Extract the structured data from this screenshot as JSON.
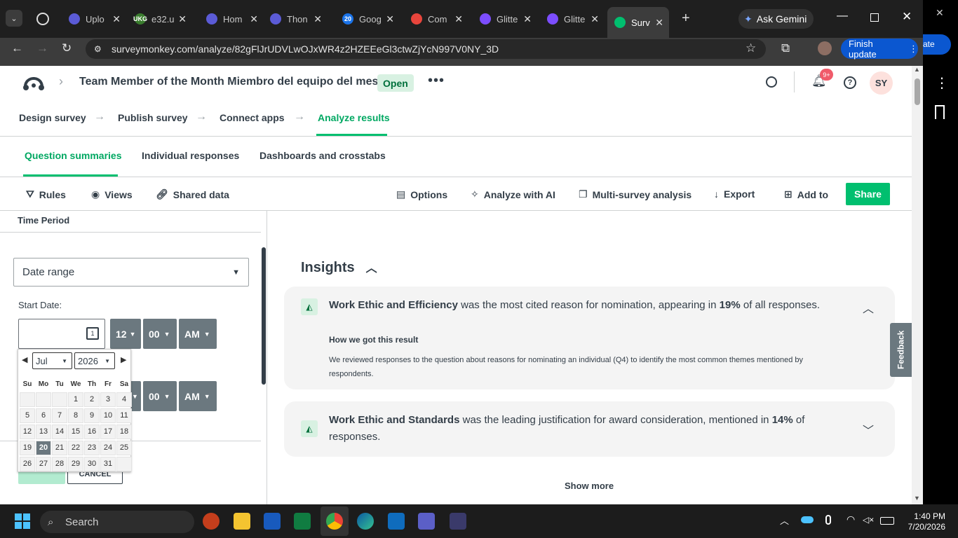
{
  "browser": {
    "tabs": [
      {
        "label": "Uplo",
        "color": "#5b5bd6"
      },
      {
        "label": "e32.u",
        "color": "#3a7d2e",
        "fav_text": "UKG"
      },
      {
        "label": "Hom",
        "color": "#5b5bd6"
      },
      {
        "label": "Thon",
        "color": "#5b5bd6"
      },
      {
        "label": "Goog",
        "color": "#1a73e8",
        "fav_text": "20"
      },
      {
        "label": "Com",
        "color": "#e8453c"
      },
      {
        "label": "Glitte",
        "color": "#7c4dff"
      },
      {
        "label": "Glitte",
        "color": "#7c4dff"
      },
      {
        "label": "Surv",
        "color": "#00bf6f"
      }
    ],
    "gemini_label": "Ask Gemini",
    "url": "surveymonkey.com/analyze/82gFlJrUDVLwOJxWR4z2HZEEeGl3ctwZjYcN997V0NY_3D",
    "finish_update": "Finish update",
    "side_partial": "ate"
  },
  "header": {
    "survey_title": "Team Member of the Month Miembro del equipo del mes",
    "status": "Open",
    "more": "•••",
    "notifications": "9+",
    "avatar": "SY"
  },
  "steps": [
    "Design survey",
    "Publish survey",
    "Connect apps",
    "Analyze results"
  ],
  "subtabs": [
    "Question summaries",
    "Individual responses",
    "Dashboards and crosstabs"
  ],
  "toolbar": {
    "rules": "Rules",
    "views": "Views",
    "shared": "Shared data",
    "options": "Options",
    "ai": "Analyze with AI",
    "multi": "Multi-survey analysis",
    "export": "Export",
    "addto": "Add to",
    "share": "Share"
  },
  "filter": {
    "time_period": "Time Period",
    "date_range": "Date range",
    "start_label": "Start Date:",
    "hour": "12",
    "minute": "00",
    "ampm": "AM",
    "cancel": "CANCEL"
  },
  "calendar": {
    "month": "Jul",
    "year": "2026",
    "dow": [
      "Su",
      "Mo",
      "Tu",
      "We",
      "Th",
      "Fr",
      "Sa"
    ],
    "weeks": [
      [
        "",
        "",
        "",
        "1",
        "2",
        "3",
        "4"
      ],
      [
        "5",
        "6",
        "7",
        "8",
        "9",
        "10",
        "11"
      ],
      [
        "12",
        "13",
        "14",
        "15",
        "16",
        "17",
        "18"
      ],
      [
        "19",
        "20",
        "21",
        "22",
        "23",
        "24",
        "25"
      ],
      [
        "26",
        "27",
        "28",
        "29",
        "30",
        "31",
        ""
      ]
    ],
    "selected": "20"
  },
  "insights": {
    "heading": "Insights",
    "card1": {
      "lead": "Work Ethic and Efficiency",
      "mid": " was the most cited reason for nomination, appearing in ",
      "pct": "19%",
      "tail": " of all responses.",
      "how_title": "How we got this result",
      "how_text": "We reviewed responses to the question about reasons for nominating an individual (Q4) to identify the most common themes mentioned by respondents."
    },
    "card2": {
      "lead": "Work Ethic and Standards",
      "mid": " was the leading justification for award consideration, mentioned in ",
      "pct": "14%",
      "tail": " of responses."
    },
    "show_more": "Show more"
  },
  "feedback": "Feedback",
  "taskbar": {
    "search": "Search",
    "time": "1:40 PM",
    "date": "7/20/2026"
  }
}
